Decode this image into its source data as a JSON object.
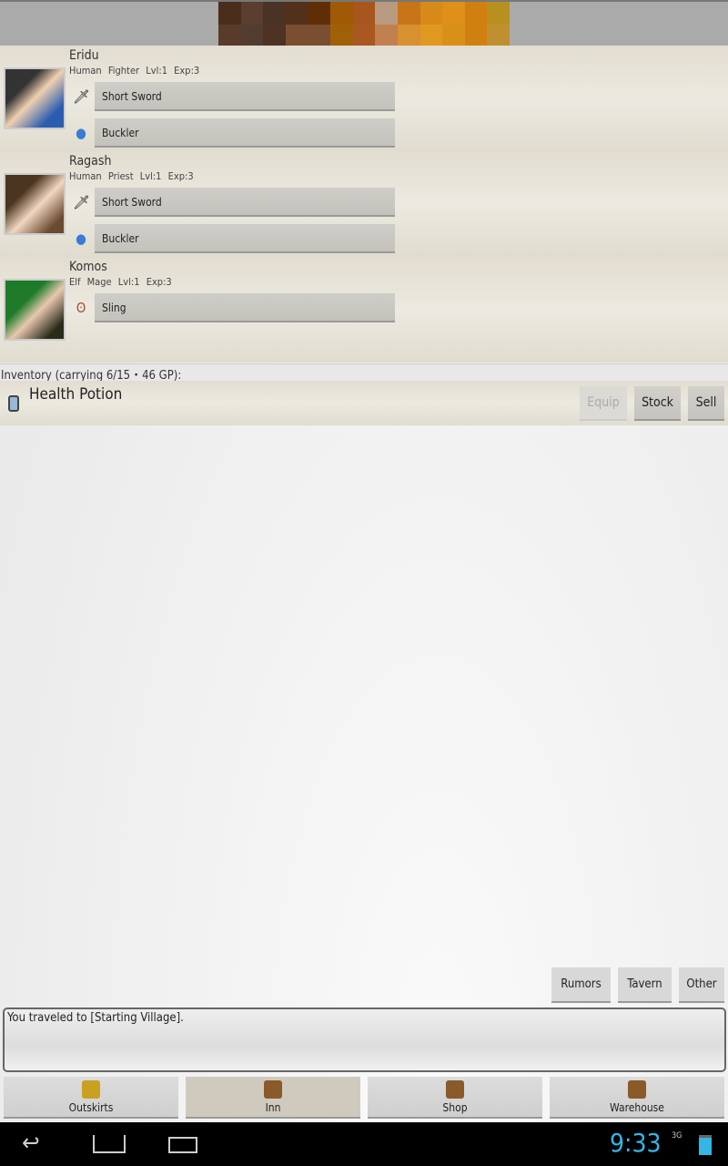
{
  "party": [
    {
      "name": "Eridu",
      "race": "Human",
      "class": "Fighter",
      "level": "Lvl:1",
      "exp": "Exp:3",
      "equipment": [
        {
          "icon": "sword-icon",
          "label": "Short Sword"
        },
        {
          "icon": "shield-icon",
          "label": "Buckler"
        }
      ]
    },
    {
      "name": "Ragash",
      "race": "Human",
      "class": "Priest",
      "level": "Lvl:1",
      "exp": "Exp:3",
      "equipment": [
        {
          "icon": "sword-icon",
          "label": "Short Sword"
        },
        {
          "icon": "shield-icon",
          "label": "Buckler"
        }
      ]
    },
    {
      "name": "Komos",
      "race": "Elf",
      "class": "Mage",
      "level": "Lvl:1",
      "exp": "Exp:3",
      "equipment": [
        {
          "icon": "sling-icon",
          "label": "Sling"
        }
      ]
    }
  ],
  "inventory": {
    "label": "Inventory (carrying 6/15・46 GP):",
    "items": [
      {
        "icon": "potion-icon",
        "name": "Health Potion"
      }
    ],
    "equip": "Equip",
    "stock": "Stock",
    "sell": "Sell"
  },
  "actions": {
    "rumors": "Rumors",
    "tavern": "Tavern",
    "other": "Other"
  },
  "log": "You traveled to [Starting Village].",
  "nav": [
    {
      "label": "Outskirts",
      "icon": "signpost-icon"
    },
    {
      "label": "Inn",
      "icon": "beer-sign-icon",
      "active": true
    },
    {
      "label": "Shop",
      "icon": "shop-sign-icon"
    },
    {
      "label": "Warehouse",
      "icon": "warehouse-sign-icon"
    }
  ],
  "status": {
    "time": "9:33",
    "network": "3G",
    "accent": "#33b5e5"
  }
}
